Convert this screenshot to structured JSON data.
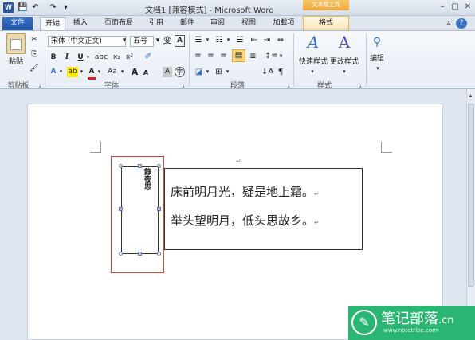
{
  "window": {
    "title": "文档1 [兼容模式] - Microsoft Word",
    "contextual_group": "文本框工具",
    "contextual_tab": "格式",
    "app_icon": "W"
  },
  "qat": {
    "icons": [
      "save-icon",
      "undo-icon",
      "redo-icon",
      "customize-icon"
    ],
    "glyphs": [
      "💾",
      "↶",
      "↷",
      "▾"
    ]
  },
  "window_controls": {
    "minimize": "–",
    "maximize": "▢",
    "close": "✕"
  },
  "tabs": [
    "文件",
    "开始",
    "插入",
    "页面布局",
    "引用",
    "邮件",
    "审阅",
    "视图",
    "加载项"
  ],
  "ribbon_right": {
    "minimize_ribbon": "▵",
    "help": "?"
  },
  "ribbon": {
    "clipboard": {
      "paste": "粘贴",
      "group": "剪贴板",
      "cut": "✂",
      "copy": "⎘",
      "painter": "🖌"
    },
    "font": {
      "group": "字体",
      "font_name": "宋体 (中文正文)",
      "font_size": "五号",
      "grow": "A",
      "shrink": "A",
      "change_case": "Aa",
      "clear_format": "A",
      "phonetic": "wén",
      "char_border": "A",
      "bold": "B",
      "italic": "I",
      "underline": "U",
      "strike": "abc",
      "sub": "x₂",
      "sup": "x²",
      "text_effect": "A",
      "highlight": "ab",
      "font_color": "A",
      "char_shade": "A",
      "enclose": "字"
    },
    "paragraph": {
      "group": "段落"
    },
    "styles": {
      "group": "样式",
      "quick_styles": "快速样式",
      "change_styles": "更改样式"
    },
    "editing": {
      "label": "编辑"
    }
  },
  "document": {
    "vertical_text": "静夜思",
    "line1": "床前明月光，疑是地上霜。",
    "line2": "举头望明月，低头思故乡。",
    "para_mark": "↵",
    "top_mark": "↵"
  },
  "watermark": {
    "title": "笔记部落",
    "cn": ".cn",
    "url": "www.notetribe.com"
  }
}
